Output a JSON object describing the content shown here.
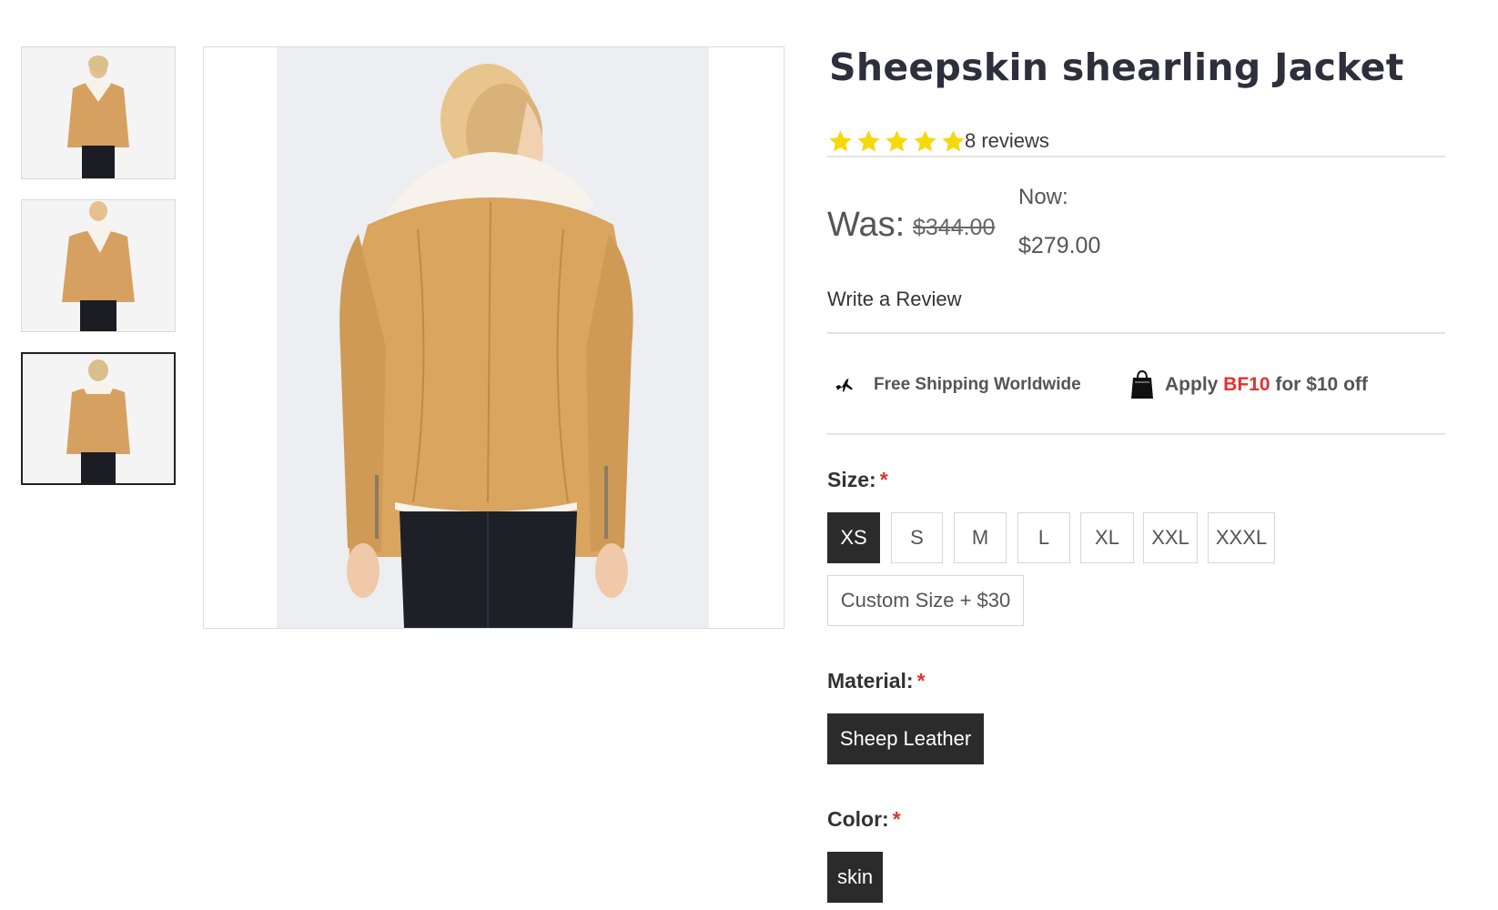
{
  "product": {
    "title": "Sheepskin shearling Jacket",
    "rating_stars": 5,
    "reviews_label": "8 reviews",
    "was_label": "Was:",
    "old_price": "$344.00",
    "now_label": "Now:",
    "new_price": "$279.00",
    "write_review": "Write a Review"
  },
  "gallery": {
    "thumbnails": [
      "front-view",
      "front-angle-view",
      "back-view"
    ],
    "active_thumbnail": 3
  },
  "perks": {
    "shipping": "Free Shipping Worldwide",
    "promo_prefix": "Apply ",
    "promo_code": "BF10",
    "promo_suffix": " for $10 off"
  },
  "size": {
    "label": "Size:",
    "required": "*",
    "options": [
      "XS",
      "S",
      "M",
      "L",
      "XL",
      "XXL",
      "XXXL"
    ],
    "custom": "Custom Size + $30",
    "selected": "XS"
  },
  "material": {
    "label": "Material:",
    "required": "*",
    "option": "Sheep Leather"
  },
  "color": {
    "label": "Color:",
    "required": "*",
    "option": "skin"
  },
  "colors": {
    "star": "#f5d90a",
    "promo_code": "#e4322b",
    "selected_bg": "#2b2b2b",
    "jacket": "#d9a55f"
  }
}
